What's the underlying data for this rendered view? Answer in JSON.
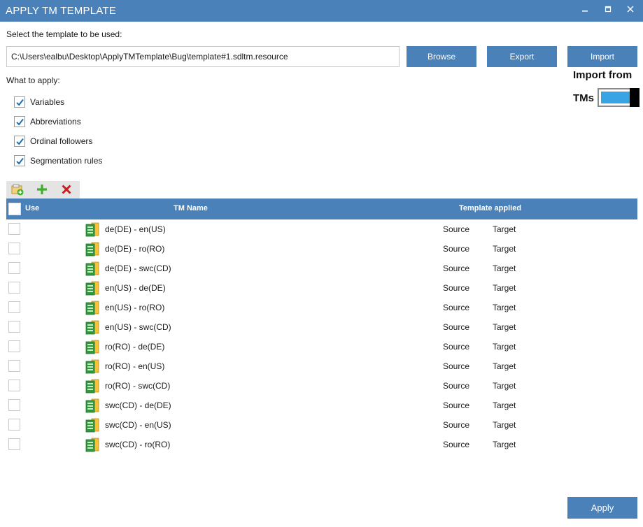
{
  "window": {
    "title": "APPLY TM TEMPLATE",
    "minimize_glyph": "🗕",
    "maximize_glyph": "🗖",
    "close_glyph": "✕"
  },
  "template": {
    "select_label": "Select the template to be used:",
    "path_value": "C:\\Users\\ealbu\\Desktop\\ApplyTMTemplate\\Bug\\template#1.sdltm.resource",
    "browse_label": "Browse",
    "export_label": "Export",
    "import_label": "Import"
  },
  "import_from": {
    "label": "Import from",
    "tms_label": "TMs",
    "toggle_on": true
  },
  "apply_options": {
    "label": "What to apply:",
    "items": [
      {
        "label": "Variables",
        "checked": true
      },
      {
        "label": "Abbreviations",
        "checked": true
      },
      {
        "label": "Ordinal followers",
        "checked": true
      },
      {
        "label": "Segmentation rules",
        "checked": true
      }
    ]
  },
  "toolbar": {
    "icons": [
      "add-tm-folder-icon",
      "add-icon",
      "remove-icon"
    ]
  },
  "grid": {
    "headers": {
      "use": "Use",
      "tm_name": "TM Name",
      "template_applied": "Template applied"
    },
    "rows": [
      {
        "name": "de(DE) - en(US)",
        "source": "Source",
        "target": "Target"
      },
      {
        "name": "de(DE) - ro(RO)",
        "source": "Source",
        "target": "Target"
      },
      {
        "name": "de(DE) - swc(CD)",
        "source": "Source",
        "target": "Target"
      },
      {
        "name": "en(US) - de(DE)",
        "source": "Source",
        "target": "Target"
      },
      {
        "name": "en(US) - ro(RO)",
        "source": "Source",
        "target": "Target"
      },
      {
        "name": "en(US) - swc(CD)",
        "source": "Source",
        "target": "Target"
      },
      {
        "name": "ro(RO) - de(DE)",
        "source": "Source",
        "target": "Target"
      },
      {
        "name": "ro(RO) - en(US)",
        "source": "Source",
        "target": "Target"
      },
      {
        "name": "ro(RO) - swc(CD)",
        "source": "Source",
        "target": "Target"
      },
      {
        "name": "swc(CD) - de(DE)",
        "source": "Source",
        "target": "Target"
      },
      {
        "name": "swc(CD) - en(US)",
        "source": "Source",
        "target": "Target"
      },
      {
        "name": "swc(CD) - ro(RO)",
        "source": "Source",
        "target": "Target"
      }
    ]
  },
  "footer": {
    "apply_label": "Apply"
  },
  "colors": {
    "accent": "#4a81b8",
    "toggle_fill": "#3aa3e3",
    "check": "#1f6fa8",
    "add_green": "#3fae29",
    "remove_red": "#c81e1e"
  }
}
